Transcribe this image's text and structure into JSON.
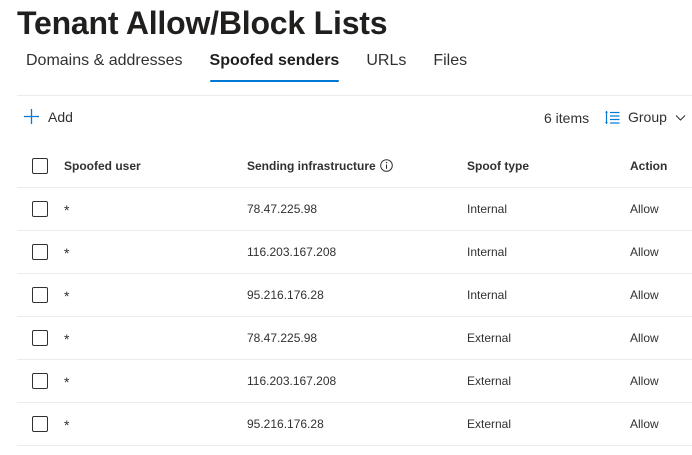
{
  "page": {
    "title": "Tenant Allow/Block Lists"
  },
  "tabs": [
    {
      "label": "Domains & addresses",
      "active": false
    },
    {
      "label": "Spoofed senders",
      "active": true
    },
    {
      "label": "URLs",
      "active": false
    },
    {
      "label": "Files",
      "active": false
    }
  ],
  "toolbar": {
    "add_label": "Add",
    "add_icon": "plus-icon",
    "items_count": "6 items",
    "group_label": "Group",
    "group_icon": "group-list-icon",
    "group_chevron_icon": "chevron-down-icon"
  },
  "table": {
    "columns": {
      "user": "Spoofed user",
      "infra": "Sending infrastructure",
      "type": "Spoof type",
      "action": "Action"
    },
    "info_icon": "info-icon",
    "rows": [
      {
        "user": "*",
        "infra": "78.47.225.98",
        "type": "Internal",
        "action": "Allow"
      },
      {
        "user": "*",
        "infra": "116.203.167.208",
        "type": "Internal",
        "action": "Allow"
      },
      {
        "user": "*",
        "infra": "95.216.176.28",
        "type": "Internal",
        "action": "Allow"
      },
      {
        "user": "*",
        "infra": "78.47.225.98",
        "type": "External",
        "action": "Allow"
      },
      {
        "user": "*",
        "infra": "116.203.167.208",
        "type": "External",
        "action": "Allow"
      },
      {
        "user": "*",
        "infra": "95.216.176.28",
        "type": "External",
        "action": "Allow"
      }
    ]
  },
  "colors": {
    "accent": "#0078d4",
    "text": "#323130",
    "divider": "#edebe9"
  }
}
